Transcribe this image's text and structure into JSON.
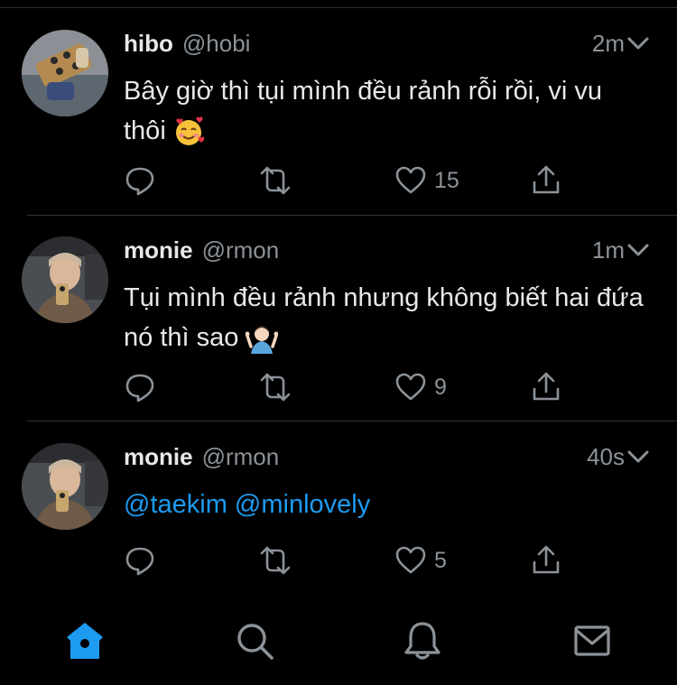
{
  "tweets": [
    {
      "name": "hibo",
      "handle": "@hobi",
      "time": "2m",
      "text": "Bây giờ thì tụi mình đều rảnh rỗi rồi, vi vu thôi",
      "emoji": "smiling-face-with-hearts",
      "likes": "15"
    },
    {
      "name": "monie",
      "handle": "@rmon",
      "time": "1m",
      "text": "Tụi mình đều rảnh nhưng không biết hai đứa nó thì sao",
      "emoji": "person-shrugging",
      "likes": "9"
    },
    {
      "name": "monie",
      "handle": "@rmon",
      "time": "40s",
      "mention1": "@taekim",
      "mention2": "@minlovely",
      "likes": "5"
    }
  ],
  "tabs": [
    "home-icon",
    "search-icon",
    "notifications-icon",
    "messages-icon"
  ],
  "colors": {
    "background": "#000000",
    "accent": "#1d9bf0",
    "muted": "#8b9298",
    "text": "#e8e8e8"
  }
}
